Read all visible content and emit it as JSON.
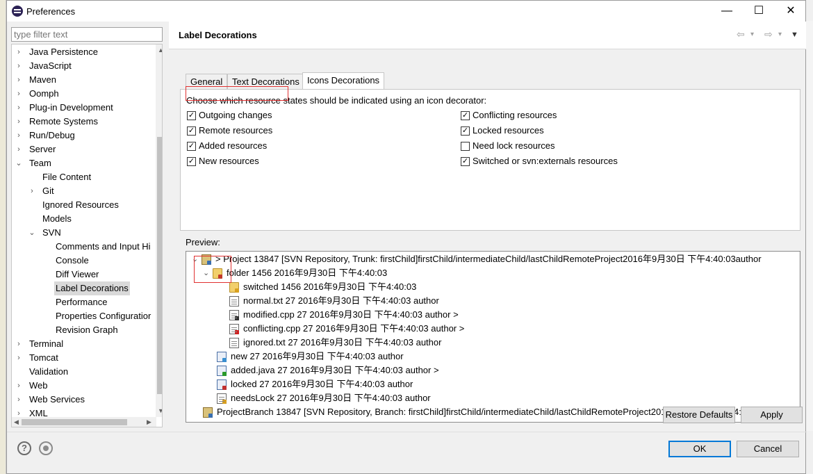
{
  "window": {
    "title": "Preferences",
    "minimize": "—",
    "maximize": "☐",
    "close": "✕"
  },
  "filter": {
    "placeholder": "type filter text"
  },
  "tree": {
    "items": [
      {
        "label": "Java Persistence",
        "level": 0,
        "toggle": "›"
      },
      {
        "label": "JavaScript",
        "level": 0,
        "toggle": "›"
      },
      {
        "label": "Maven",
        "level": 0,
        "toggle": "›"
      },
      {
        "label": "Oomph",
        "level": 0,
        "toggle": "›"
      },
      {
        "label": "Plug-in Development",
        "level": 0,
        "toggle": "›"
      },
      {
        "label": "Remote Systems",
        "level": 0,
        "toggle": "›"
      },
      {
        "label": "Run/Debug",
        "level": 0,
        "toggle": "›"
      },
      {
        "label": "Server",
        "level": 0,
        "toggle": "›"
      },
      {
        "label": "Team",
        "level": 0,
        "toggle": "⌄"
      },
      {
        "label": "File Content",
        "level": 1,
        "toggle": ""
      },
      {
        "label": "Git",
        "level": 1,
        "toggle": "›"
      },
      {
        "label": "Ignored Resources",
        "level": 1,
        "toggle": ""
      },
      {
        "label": "Models",
        "level": 1,
        "toggle": ""
      },
      {
        "label": "SVN",
        "level": 1,
        "toggle": "⌄"
      },
      {
        "label": "Comments and Input Hi",
        "level": 2,
        "toggle": ""
      },
      {
        "label": "Console",
        "level": 2,
        "toggle": ""
      },
      {
        "label": "Diff Viewer",
        "level": 2,
        "toggle": ""
      },
      {
        "label": "Label Decorations",
        "level": 2,
        "toggle": "",
        "selected": true
      },
      {
        "label": "Performance",
        "level": 2,
        "toggle": ""
      },
      {
        "label": "Properties Configuratior",
        "level": 2,
        "toggle": ""
      },
      {
        "label": "Revision Graph",
        "level": 2,
        "toggle": ""
      },
      {
        "label": "Terminal",
        "level": 0,
        "toggle": "›"
      },
      {
        "label": "Tomcat",
        "level": 0,
        "toggle": "›"
      },
      {
        "label": "Validation",
        "level": 0,
        "toggle": ""
      },
      {
        "label": "Web",
        "level": 0,
        "toggle": "›"
      },
      {
        "label": "Web Services",
        "level": 0,
        "toggle": "›"
      },
      {
        "label": "XML",
        "level": 0,
        "toggle": "›"
      }
    ]
  },
  "page": {
    "title": "Label Decorations",
    "tabs": [
      {
        "label": "General"
      },
      {
        "label": "Text Decorations"
      },
      {
        "label": "Icons Decorations",
        "active": true
      }
    ],
    "description": "Choose which resource states should be indicated using an icon decorator:",
    "checkboxes_left": [
      {
        "label": "Outgoing changes",
        "checked": true
      },
      {
        "label": "Remote resources",
        "checked": true
      },
      {
        "label": "Added resources",
        "checked": true
      },
      {
        "label": "New resources",
        "checked": true
      }
    ],
    "checkboxes_right": [
      {
        "label": "Conflicting resources",
        "checked": true
      },
      {
        "label": "Locked resources",
        "checked": true
      },
      {
        "label": "Need lock resources",
        "checked": false
      },
      {
        "label": "Switched or svn:externals resources",
        "checked": true
      }
    ],
    "preview_label": "Preview:",
    "preview_rows": [
      {
        "text": "> Project 13847 [SVN Repository, Trunk: firstChild]firstChild/intermediateChild/lastChildRemoteProject2016年9月30日 下午4:40:03author",
        "icon": "project",
        "overlay": "#3a6fb0",
        "toggle": "⌄",
        "level": 0
      },
      {
        "text": "folder  1456  2016年9月30日 下午4:40:03",
        "icon": "folder",
        "overlay": "#c23a2b",
        "toggle": "⌄",
        "level": 1
      },
      {
        "text": "switched  1456  2016年9月30日 下午4:40:03",
        "icon": "folder",
        "overlay": "#d8a020",
        "toggle": "",
        "level": 2
      },
      {
        "text": "normal.txt 27 2016年9月30日 下午4:40:03 author",
        "icon": "file",
        "overlay": "",
        "toggle": "",
        "level": 3
      },
      {
        "text": "modified.cpp 27 2016年9月30日 下午4:40:03 author >",
        "icon": "file",
        "overlay": "#333333",
        "toggle": "",
        "level": 3
      },
      {
        "text": "conflicting.cpp 27 2016年9月30日 下午4:40:03 author >",
        "icon": "file",
        "overlay": "#d02020",
        "toggle": "",
        "level": 3
      },
      {
        "text": "ignored.txt 27 2016年9月30日 下午4:40:03 author",
        "icon": "file",
        "overlay": "",
        "toggle": "",
        "level": 3
      },
      {
        "text": "new 27 2016年9月30日 下午4:40:03 author",
        "icon": "java",
        "overlay": "#3a8fd0",
        "toggle": "",
        "level": 2
      },
      {
        "text": "added.java 27 2016年9月30日 下午4:40:03 author >",
        "icon": "java",
        "overlay": "#2a9a2a",
        "toggle": "",
        "level": 2
      },
      {
        "text": "locked 27 2016年9月30日 下午4:40:03 author",
        "icon": "java",
        "overlay": "#c03030",
        "toggle": "",
        "level": 2
      },
      {
        "text": "needsLock 27 2016年9月30日 下午4:40:03 author",
        "icon": "file",
        "overlay": "#d8a020",
        "toggle": "",
        "level": 2
      },
      {
        "text": "ProjectBranch 13847 [SVN Repository, Branch: firstChild]firstChild/intermediateChild/lastChildRemoteProject2016年9月30日 下午4:40:03author",
        "icon": "project",
        "overlay": "#3a6fb0",
        "toggle": "",
        "level": 0
      }
    ]
  },
  "buttons": {
    "restore_defaults": "Restore Defaults",
    "apply": "Apply",
    "ok": "OK",
    "cancel": "Cancel"
  },
  "icons": {
    "help": "?",
    "nav_back": "⇦",
    "nav_forward": "⇨",
    "nav_dropdown": "▾",
    "view_menu": "▼"
  },
  "colors": {
    "accent": "#0078d7",
    "selection": "#d9d9d9",
    "highlight_box": "#e03030"
  }
}
